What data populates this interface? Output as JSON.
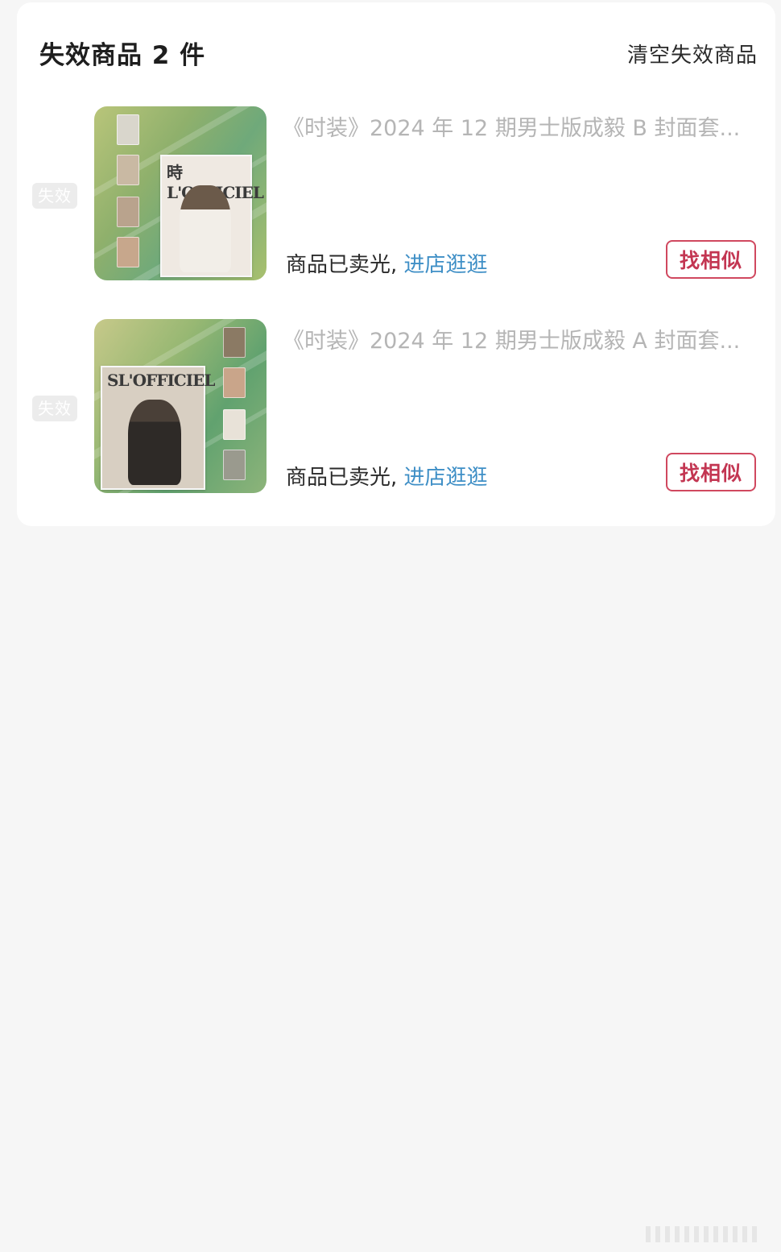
{
  "header": {
    "title": "失效商品 2 件",
    "clear_label": "清空失效商品"
  },
  "items": [
    {
      "badge": "失效",
      "title": "《时装》2024 年 12 期男士版成毅 B 封面套...",
      "status_text": "商品已卖光,",
      "shop_link": "进店逛逛",
      "similar_label": "找相似"
    },
    {
      "badge": "失效",
      "title": "《时装》2024 年 12 期男士版成毅 A 封面套...",
      "status_text": "商品已卖光,",
      "shop_link": "进店逛逛",
      "similar_label": "找相似"
    }
  ],
  "colors": {
    "accent_red": "#c33652",
    "link_blue": "#3f8fc6",
    "muted_gray": "#b5b5b5"
  }
}
